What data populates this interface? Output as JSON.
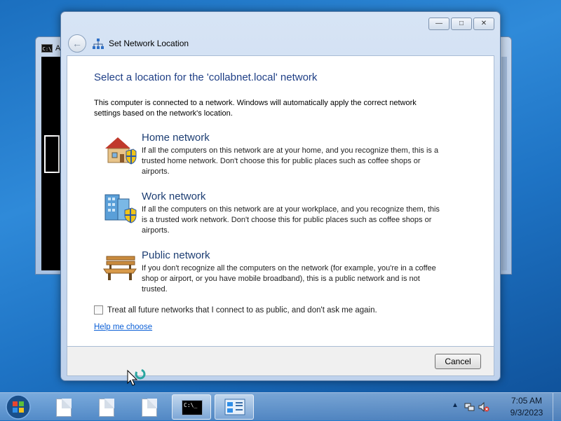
{
  "console_window": {
    "icon_label": "C:\\",
    "title": "A"
  },
  "dialog": {
    "title": "Set Network Location",
    "caption_buttons": {
      "minimize": "—",
      "maximize": "□",
      "close": "✕"
    },
    "heading": "Select a location for the 'collabnet.local' network",
    "intro": "This computer is connected to a network. Windows will automatically apply the correct network settings based on the network's location.",
    "options": [
      {
        "title": "Home network",
        "description": "If all the computers on this network are at your home, and you recognize them, this is a trusted home network.  Don't choose this for public places such as coffee shops or airports.",
        "icon": "house-icon"
      },
      {
        "title": "Work network",
        "description": "If all the computers on this network are at your workplace, and you recognize them, this is a trusted work network.  Don't choose this for public places such as coffee shops or airports.",
        "icon": "office-building-icon"
      },
      {
        "title": "Public network",
        "description": "If you don't recognize all the computers on the network (for example, you're in a coffee shop or airport, or you have mobile broadband), this is a public network and is not trusted.",
        "icon": "park-bench-icon"
      }
    ],
    "checkbox_label": "Treat all future networks that I connect to as public, and don't ask me again.",
    "checkbox_checked": false,
    "help_link": "Help me choose",
    "cancel_label": "Cancel"
  },
  "taskbar": {
    "items": [
      "document-icon",
      "document-icon",
      "document-icon",
      "command-prompt-icon",
      "network-control-panel-icon"
    ],
    "active_items": [
      3,
      4
    ],
    "console_icon_label": "C:\\_",
    "clock_time": "7:05 AM",
    "clock_date": "9/3/2023"
  },
  "colors": {
    "heading": "#1f3f86",
    "link": "#0b5fd6",
    "desktop": "#1e73c4"
  }
}
